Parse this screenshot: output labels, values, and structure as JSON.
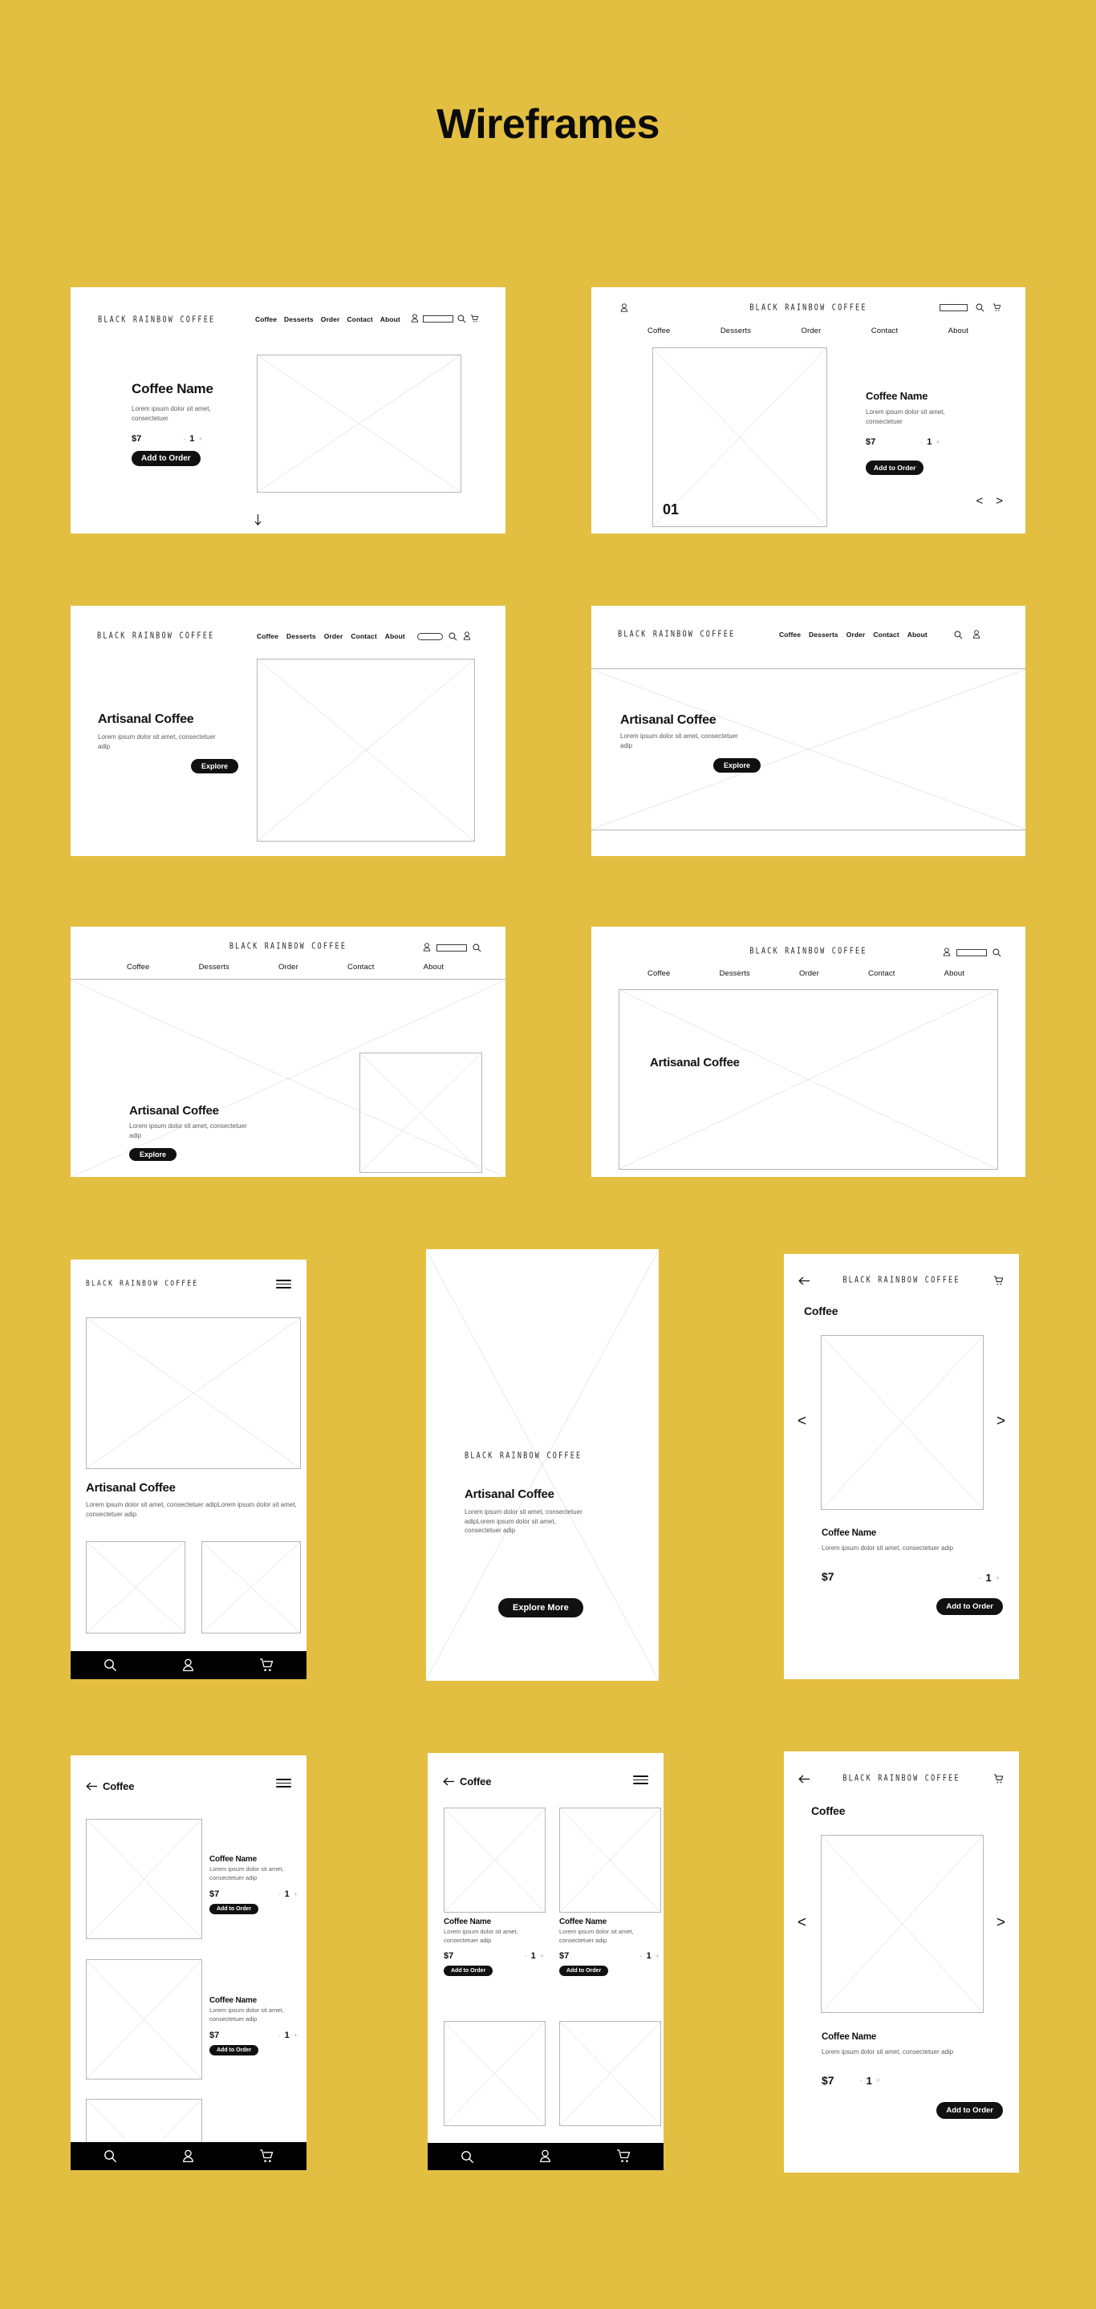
{
  "page": {
    "title": "Wireframes",
    "background_color": "#e3bf41"
  },
  "brand": {
    "name": "BLACK RAINBOW COFFEE"
  },
  "nav": {
    "items": [
      "Coffee",
      "Desserts",
      "Order",
      "Contact",
      "About"
    ]
  },
  "icons": {
    "account": "account-icon",
    "search": "search-icon",
    "cart": "cart-icon",
    "menu": "hamburger-icon",
    "back": "back-arrow-icon",
    "down": "down-arrow-icon",
    "prev": "chevron-left-icon",
    "next": "chevron-right-icon"
  },
  "product": {
    "name": "Coffee Name",
    "desc_2line": "Lorem ipsum dolor sit amet, consectetuer",
    "desc_short": "Lorem ipsum dolor sit amet, consectetuer adip",
    "desc_list": "Lorem ipsum dolor sit amet, consectetuer adip",
    "price": "$7",
    "qty": "1",
    "minus": "-",
    "plus": "+",
    "add_label": "Add to Order"
  },
  "hero": {
    "title": "Artisanal Coffee",
    "desc": "Lorem ipsum dolor sit amet, consectetuer adip",
    "desc_long": "Lorem ipsum dolor sit amet, consectetuer adipLorem ipsum dolor sit amet, consectetuer adip",
    "explore_label": "Explore",
    "explore_more_label": "Explore More"
  },
  "labels": {
    "coffee_page": "Coffee",
    "slide_number": "01",
    "back_coffee": "Coffee"
  },
  "wireframes": [
    {
      "id": "w1",
      "kind": "desktop",
      "name": "desktop-product-detail-left-nav"
    },
    {
      "id": "w2",
      "kind": "desktop",
      "name": "desktop-product-detail-centered-brand"
    },
    {
      "id": "w3",
      "kind": "desktop",
      "name": "desktop-hero-split"
    },
    {
      "id": "w4",
      "kind": "desktop",
      "name": "desktop-hero-fullbleed"
    },
    {
      "id": "w5",
      "kind": "desktop",
      "name": "desktop-hero-centered-nav-inset"
    },
    {
      "id": "w6",
      "kind": "desktop",
      "name": "desktop-hero-centered-nav-full"
    },
    {
      "id": "m1",
      "kind": "mobile",
      "name": "mobile-home-feed"
    },
    {
      "id": "m2",
      "kind": "mobile",
      "name": "mobile-splash-hero"
    },
    {
      "id": "m3",
      "kind": "mobile",
      "name": "mobile-product-carousel"
    },
    {
      "id": "m4",
      "kind": "mobile",
      "name": "mobile-product-list"
    },
    {
      "id": "m5",
      "kind": "mobile",
      "name": "mobile-product-grid"
    },
    {
      "id": "m6",
      "kind": "mobile",
      "name": "mobile-product-carousel-alt"
    }
  ]
}
